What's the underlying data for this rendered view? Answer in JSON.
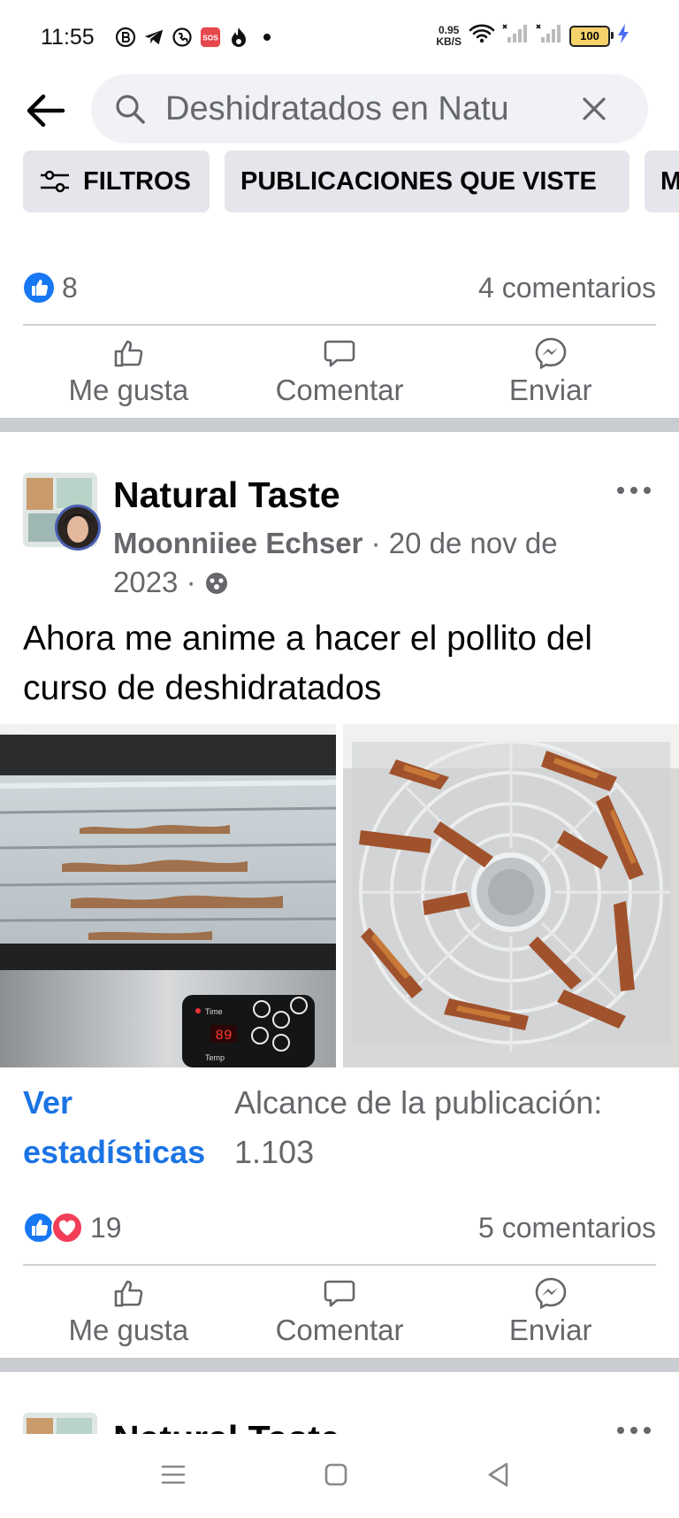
{
  "status_bar": {
    "time": "11:55",
    "net_speed_value": "0.95",
    "net_speed_unit": "KB/S",
    "battery": "100",
    "icons": [
      "b-circle-icon",
      "telegram-icon",
      "whatsapp-icon",
      "sos-icon",
      "fire-icon",
      "dot-icon",
      "wifi-icon",
      "signal-icon",
      "signal-icon",
      "charging-icon"
    ]
  },
  "search": {
    "query": "Deshidratados en Natu"
  },
  "chips": [
    {
      "label": "FILTROS"
    },
    {
      "label": "PUBLICACIONES QUE VISTE"
    },
    {
      "label": "M"
    }
  ],
  "prev_post": {
    "like_count": "8",
    "comments": "4 comentarios",
    "actions": {
      "like": "Me gusta",
      "comment": "Comentar",
      "send": "Enviar"
    }
  },
  "post": {
    "page_name": "Natural Taste",
    "author": "Moonniiee Echser",
    "date_line1": " · 20 de nov de",
    "date_line2": "2023 · ",
    "text": "Ahora me anime a hacer el pollito del curso de deshidratados",
    "dehydrator_display": "89",
    "panel_time": "Time",
    "panel_temp": "Temp",
    "stats_link_1": "Ver",
    "stats_link_2": "estadísticas",
    "reach_label": "Alcance de la publicación:",
    "reach_value": "1.103",
    "reaction_count": "19",
    "comments": "5 comentarios",
    "actions": {
      "like": "Me gusta",
      "comment": "Comentar",
      "send": "Enviar"
    }
  },
  "next_post": {
    "page_name": "Natural Taste"
  },
  "colors": {
    "accent": "#1b74e4",
    "like_blue": "#1877f2",
    "love_red": "#f33e58",
    "secondary_text": "#65676b",
    "separator": "#c9ccd1"
  }
}
